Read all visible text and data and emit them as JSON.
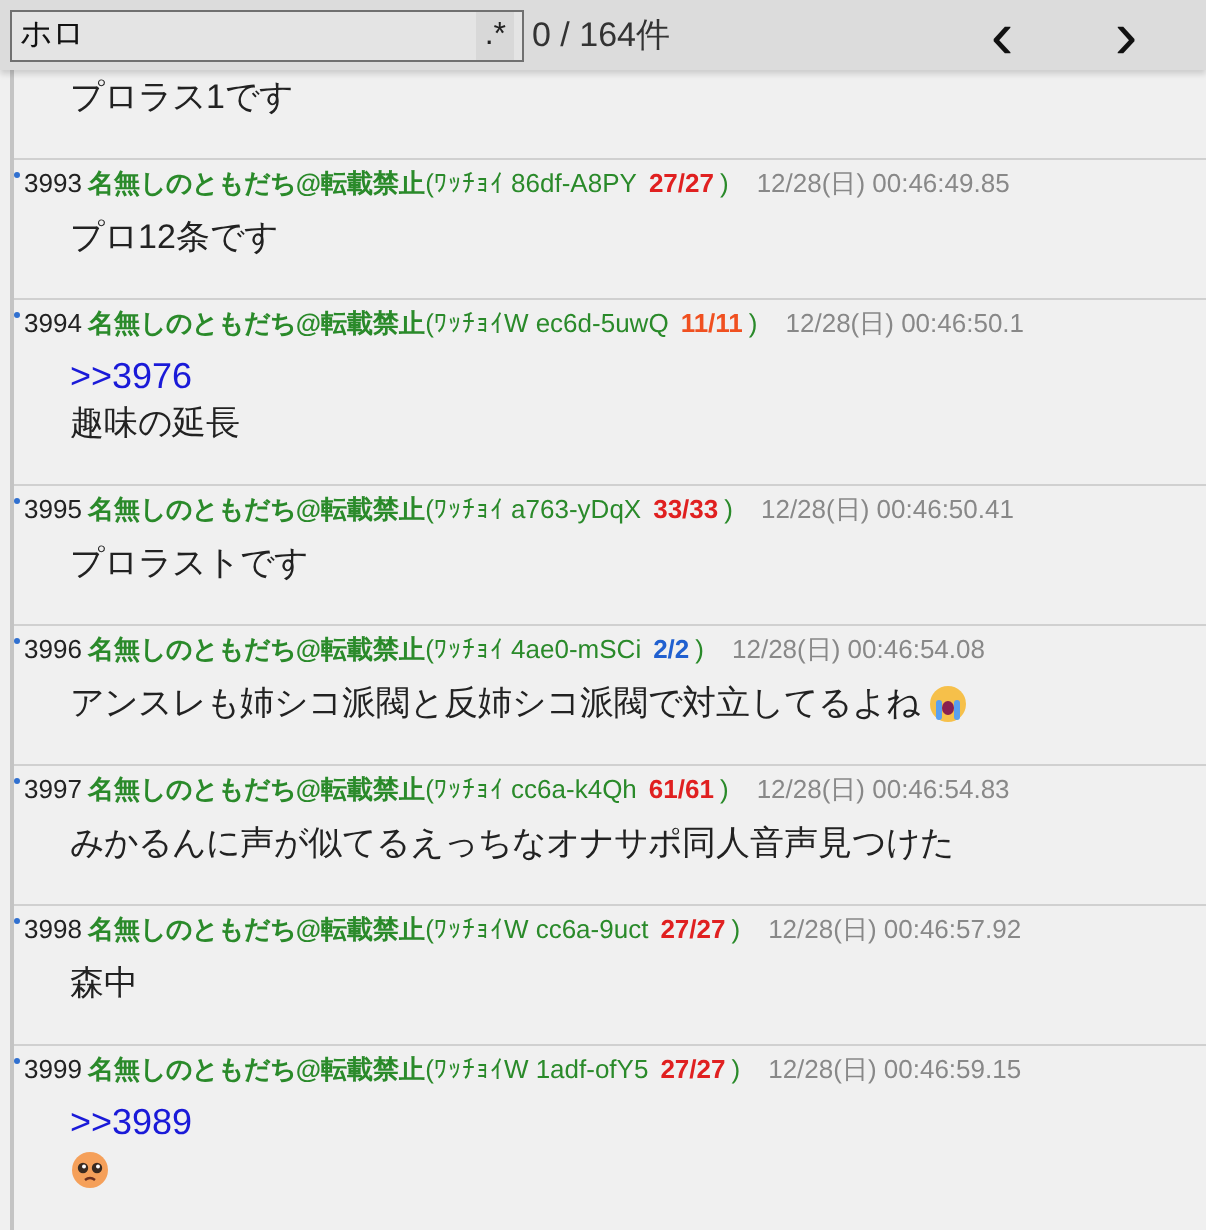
{
  "search": {
    "value": "ホロ",
    "regex_label": ".*",
    "result_count": "0 / 164件",
    "prev_label": "‹",
    "next_label": "›"
  },
  "fragment": {
    "body": [
      {
        "kind": "text",
        "text": "プロラス1です"
      }
    ]
  },
  "posts": [
    {
      "number": "3993",
      "name": "名無しのともだち@転載禁止",
      "id": "(ﾜｯﾁｮｲ 86df-A8PY",
      "count": "27/27",
      "color": "#e02020",
      "close": ")",
      "date": "12/28(日) 00:46:49.85",
      "body": [
        {
          "kind": "text",
          "text": "プロ12条です"
        }
      ]
    },
    {
      "number": "3994",
      "name": "名無しのともだち@転載禁止",
      "id": "(ﾜｯﾁｮｲW ec6d-5uwQ",
      "count": "11/11",
      "color": "#f05020",
      "close": ")",
      "date": "12/28(日) 00:46:50.1",
      "body": [
        {
          "kind": "anchor",
          "text": ">>3976"
        },
        {
          "kind": "text",
          "text": "趣味の延長"
        }
      ]
    },
    {
      "number": "3995",
      "name": "名無しのともだち@転載禁止",
      "id": "(ﾜｯﾁｮｲ a763-yDqX",
      "count": "33/33",
      "color": "#e02020",
      "close": ")",
      "date": "12/28(日) 00:46:50.41",
      "body": [
        {
          "kind": "text",
          "text": "プロラストです"
        }
      ]
    },
    {
      "number": "3996",
      "name": "名無しのともだち@転載禁止",
      "id": "(ﾜｯﾁｮｲ 4ae0-mSCi",
      "count": "2/2",
      "color": "#2060d0",
      "close": ")",
      "date": "12/28(日) 00:46:54.08",
      "body": [
        {
          "kind": "text",
          "text": "アンスレも姉シコ派閥と反姉シコ派閥で対立してるよね",
          "crying_emoji": true
        }
      ]
    },
    {
      "number": "3997",
      "name": "名無しのともだち@転載禁止",
      "id": "(ﾜｯﾁｮｲ cc6a-k4Qh",
      "count": "61/61",
      "color": "#e02020",
      "close": ")",
      "date": "12/28(日) 00:46:54.83",
      "body": [
        {
          "kind": "text",
          "text": "みかるんに声が似てるえっちなオナサポ同人音声見つけた"
        }
      ]
    },
    {
      "number": "3998",
      "name": "名無しのともだち@転載禁止",
      "id": "(ﾜｯﾁｮｲW cc6a-9uct",
      "count": "27/27",
      "color": "#e02020",
      "close": ")",
      "date": "12/28(日) 00:46:57.92",
      "body": [
        {
          "kind": "text",
          "text": "森中"
        }
      ]
    },
    {
      "number": "3999",
      "name": "名無しのともだち@転載禁止",
      "id": "(ﾜｯﾁｮｲW 1adf-ofY5",
      "count": "27/27",
      "color": "#e02020",
      "close": ")",
      "date": "12/28(日) 00:46:59.15",
      "body": [
        {
          "kind": "anchor",
          "text": ">>3989"
        },
        {
          "kind": "pleading"
        }
      ]
    }
  ]
}
